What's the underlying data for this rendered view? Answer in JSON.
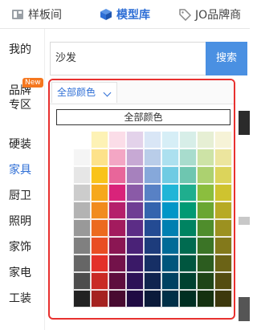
{
  "tabs": [
    {
      "label": "样板间",
      "icon": "sample-room-icon",
      "active": false
    },
    {
      "label": "模型库",
      "icon": "cube-icon",
      "active": true
    },
    {
      "label": "JO品牌商",
      "icon": "tag-icon",
      "active": false
    }
  ],
  "sidebar": {
    "items": [
      {
        "label": "我的"
      },
      {
        "label": "品牌\n专区",
        "badge": "New"
      },
      {
        "label": "硬装"
      },
      {
        "label": "家具",
        "active": true
      },
      {
        "label": "厨卫"
      },
      {
        "label": "照明"
      },
      {
        "label": "家饰"
      },
      {
        "label": "家电"
      },
      {
        "label": "工装"
      }
    ]
  },
  "search": {
    "value": "沙发",
    "button_label": "搜索"
  },
  "color_filter": {
    "selected": "全部颜色",
    "all_button_label": "全部颜色",
    "swatches": [
      [
        "#ffffff",
        "#fdf2b5",
        "#fbdde8",
        "#e3d2ea",
        "#d9e6f6",
        "#d6eef6",
        "#d7eee8",
        "#e6efd4",
        "#f6f3d7",
        "#ebe4de"
      ],
      [
        "#f5f5f5",
        "#fde28a",
        "#f3a6c4",
        "#c7a9d4",
        "#b9cde9",
        "#ace0ef",
        "#a8dccd",
        "#cde3a6",
        "#ece59e",
        "#d8ccbf"
      ],
      [
        "#e6e6e6",
        "#f9c31a",
        "#e8669a",
        "#a681bd",
        "#86a8da",
        "#6fcbe3",
        "#6ec6b0",
        "#acd170",
        "#dcd45b",
        "#c2ae9c"
      ],
      [
        "#cccccc",
        "#f6a81c",
        "#d9237a",
        "#8a5aa7",
        "#5881c5",
        "#20b5d7",
        "#1fae8e",
        "#8bbe3e",
        "#cfc32f",
        "#a88e79"
      ],
      [
        "#b3b3b3",
        "#f18b1e",
        "#b51f6b",
        "#6f3d93",
        "#3464ae",
        "#0096c7",
        "#009a74",
        "#6aa632",
        "#b7aa25",
        "#8e705a"
      ],
      [
        "#999999",
        "#ec6a1f",
        "#a31b5e",
        "#5c2d86",
        "#244b93",
        "#0080b1",
        "#008361",
        "#4f8d2c",
        "#9c9120",
        "#745541"
      ],
      [
        "#808080",
        "#e94d24",
        "#8b1653",
        "#4a2277",
        "#1d3c7c",
        "#006b97",
        "#006b50",
        "#3b7426",
        "#83791b",
        "#5d412e"
      ],
      [
        "#666666",
        "#e3302a",
        "#73124a",
        "#3a1967",
        "#162f65",
        "#00567c",
        "#00563f",
        "#2c5c1f",
        "#6b6316",
        "#493223"
      ],
      [
        "#4d4d4d",
        "#c92a25",
        "#5e0e3e",
        "#2d1256",
        "#10244f",
        "#004262",
        "#004230",
        "#1f4517",
        "#544d11",
        "#38261a"
      ],
      [
        "#222222",
        "#a52220",
        "#480a30",
        "#200b43",
        "#0b1a3a",
        "#002f47",
        "#002f22",
        "#153110",
        "#3d380c",
        "#271a12"
      ]
    ]
  }
}
